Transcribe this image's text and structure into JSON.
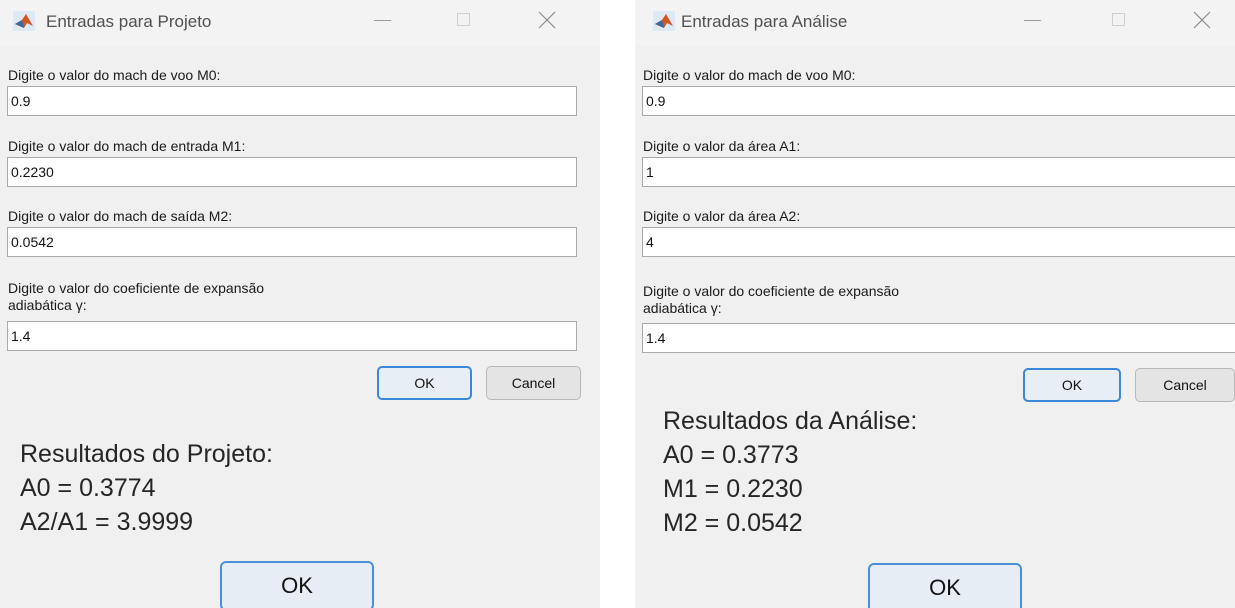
{
  "left_dialog": {
    "title": "Entradas para Projeto",
    "prompts": [
      {
        "label": "Digite o valor do mach de voo M0:",
        "value": "0.9"
      },
      {
        "label": "Digite o valor do mach de entrada M1:",
        "value": "0.2230"
      },
      {
        "label": "Digite o valor do mach de saída M2:",
        "value": "0.0542"
      },
      {
        "label": "Digite o valor do coeficiente de expansão",
        "label2": "adiabática γ:",
        "value": "1.4"
      }
    ],
    "ok_label": "OK",
    "cancel_label": "Cancel",
    "results": {
      "heading": "Resultados do Projeto:",
      "lines": [
        "A0 = 0.3774",
        "A2/A1 = 3.9999"
      ],
      "ok_label": "OK"
    }
  },
  "right_dialog": {
    "title": "Entradas para Análise",
    "prompts": [
      {
        "label": "Digite o valor do mach de voo M0:",
        "value": "0.9"
      },
      {
        "label": "Digite o valor da área A1:",
        "value": "1"
      },
      {
        "label": "Digite o valor da área A2:",
        "value": "4"
      },
      {
        "label": "Digite o valor do coeficiente de expansão",
        "label2": "adiabática γ:",
        "value": "1.4"
      }
    ],
    "ok_label": "OK",
    "cancel_label": "Cancel",
    "results": {
      "heading": "Resultados da Análise:",
      "lines": [
        "A0 = 0.3773",
        "M1 = 0.2230",
        "M2 = 0.0542"
      ],
      "ok_label": "OK"
    }
  },
  "icons": {
    "app": "matlab-logo-icon",
    "minimize": "minimize-icon",
    "maximize": "maximize-icon",
    "close": "close-icon"
  },
  "colors": {
    "dialog_bg": "#f0f0f0",
    "accent": "#3b87d8"
  }
}
